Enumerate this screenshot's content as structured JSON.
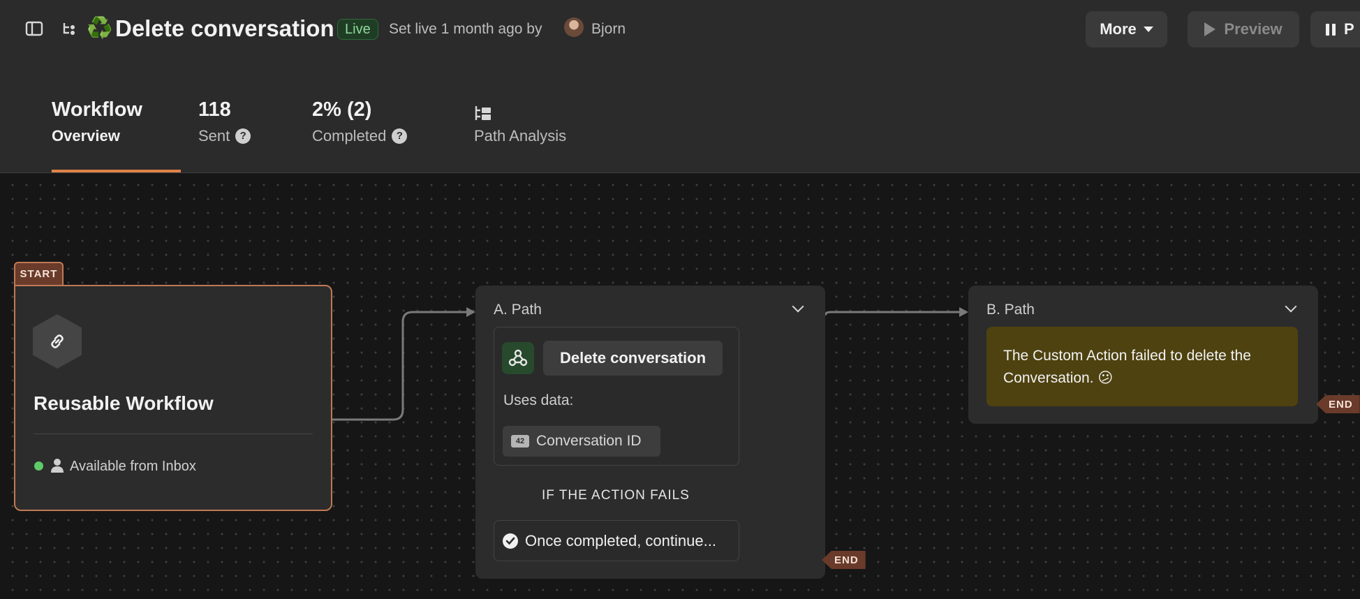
{
  "topbar": {
    "sidebar_toggle_icon": "sidebar-toggle-icon",
    "workflow_icon": "workflow-icon",
    "title_emoji": "♻️",
    "title": "Delete conversation",
    "status_badge": "Live",
    "set_live_text": "Set live 1 month ago by",
    "author": "Bjorn",
    "more_label": "More",
    "preview_label": "Preview",
    "pause_label": "P"
  },
  "tabs": [
    {
      "big": "Workflow",
      "small": "Overview",
      "active": true
    },
    {
      "big": "118",
      "small": "Sent",
      "help": "?"
    },
    {
      "big": "2% (2)",
      "small": "Completed",
      "help": "?"
    },
    {
      "icon": "path-analysis-icon",
      "small": "Path Analysis"
    }
  ],
  "canvas": {
    "start_node": {
      "tag": "START",
      "icon": "link-icon",
      "title": "Reusable Workflow",
      "availability": "Available from Inbox",
      "status_color": "#5ecb6b"
    },
    "path_a": {
      "label": "A. Path",
      "action_icon": "webhook-icon",
      "action_label": "Delete conversation",
      "uses_data_label": "Uses data:",
      "data_badge": "42",
      "data_label": "Conversation ID",
      "fail_label": "IF THE ACTION FAILS",
      "continue_label": "Once completed, continue...",
      "end_tag": "END"
    },
    "path_b": {
      "label": "B. Path",
      "message": "The Custom Action failed to delete the Conversation. 😕",
      "end_tag": "END"
    }
  },
  "colors": {
    "accent": "#e0834a",
    "start_border": "#c07a55",
    "message_bg": "#4e4210",
    "live_badge": "#1f3d25"
  }
}
